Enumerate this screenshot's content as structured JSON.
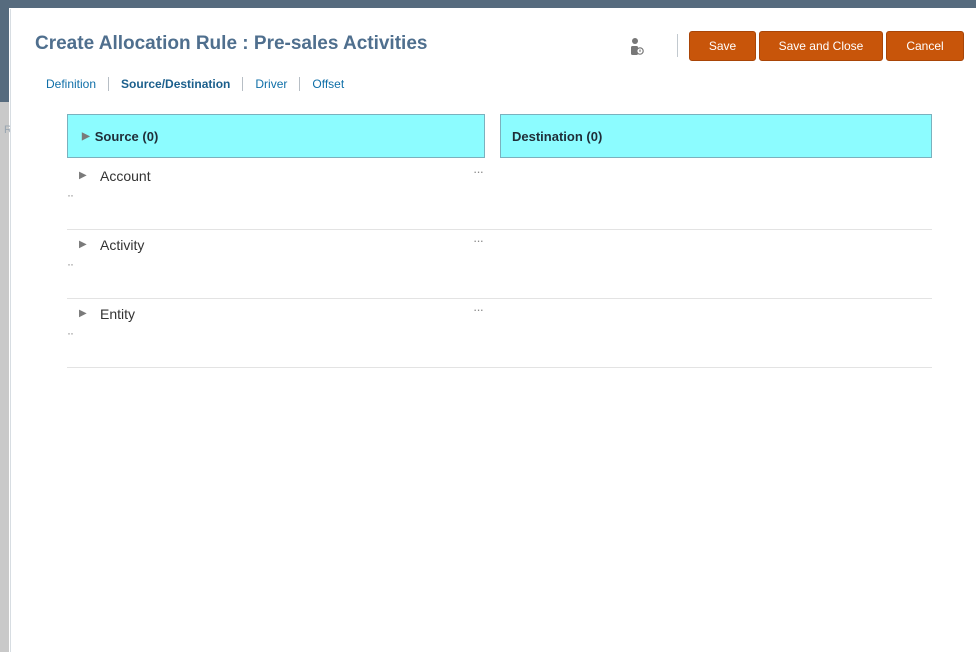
{
  "dialog": {
    "title": "Create Allocation Rule : Pre-sales Activities",
    "buttons": {
      "save": "Save",
      "save_and_close": "Save and Close",
      "cancel": "Cancel"
    },
    "icons": {
      "user": "user-info-icon"
    },
    "accent_color": "#c8550a"
  },
  "tabs": [
    {
      "label": "Definition",
      "active": false
    },
    {
      "label": "Source/Destination",
      "active": true
    },
    {
      "label": "Driver",
      "active": false
    },
    {
      "label": "Offset",
      "active": false
    }
  ],
  "source": {
    "header": "Source (0)",
    "dimensions": [
      {
        "label": "Account",
        "more": "···",
        "sub": "··"
      },
      {
        "label": "Activity",
        "more": "···",
        "sub": "··"
      },
      {
        "label": "Entity",
        "more": "···",
        "sub": "··"
      }
    ]
  },
  "destination": {
    "header": "Destination (0)"
  },
  "colors": {
    "panel_header_bg": "#8cfcff",
    "title": "#4f6f8e",
    "link": "#0f6fa8"
  }
}
